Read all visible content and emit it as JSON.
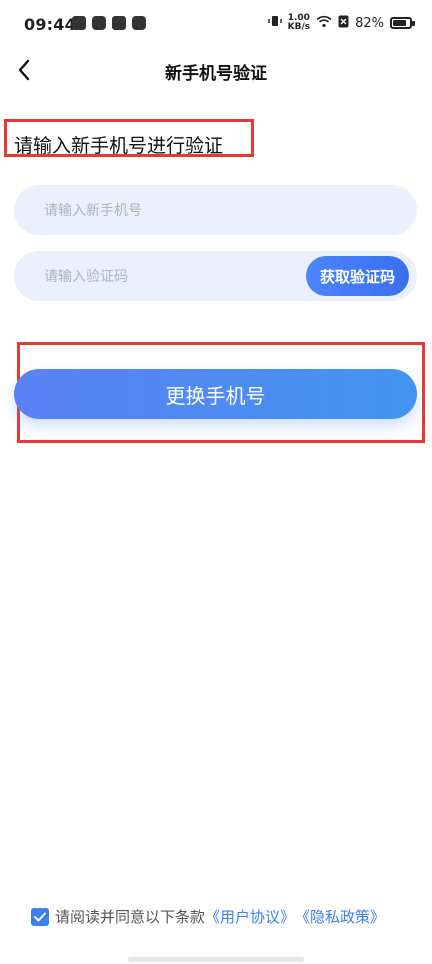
{
  "status_bar": {
    "time": "09:44",
    "net_speed_value": "1.00",
    "net_speed_unit": "KB/s",
    "battery_percent": "82%",
    "battery_level": 0.82
  },
  "header": {
    "title": "新手机号验证"
  },
  "form": {
    "subtitle": "请输入新手机号进行验证",
    "phone_placeholder": "请输入新手机号",
    "code_placeholder": "请输入验证码",
    "get_code_label": "获取验证码"
  },
  "actions": {
    "primary_label": "更换手机号"
  },
  "agreement": {
    "text": "请阅读并同意以下条款",
    "user_agreement": "《用户协议》",
    "privacy_policy": "《隐私政策》"
  },
  "colors": {
    "accent": "#3f7ff2",
    "highlight_box": "#e53935",
    "input_bg": "#eaf1fd"
  },
  "icons": {
    "back": "chevron-left-icon",
    "check": "check-icon"
  }
}
